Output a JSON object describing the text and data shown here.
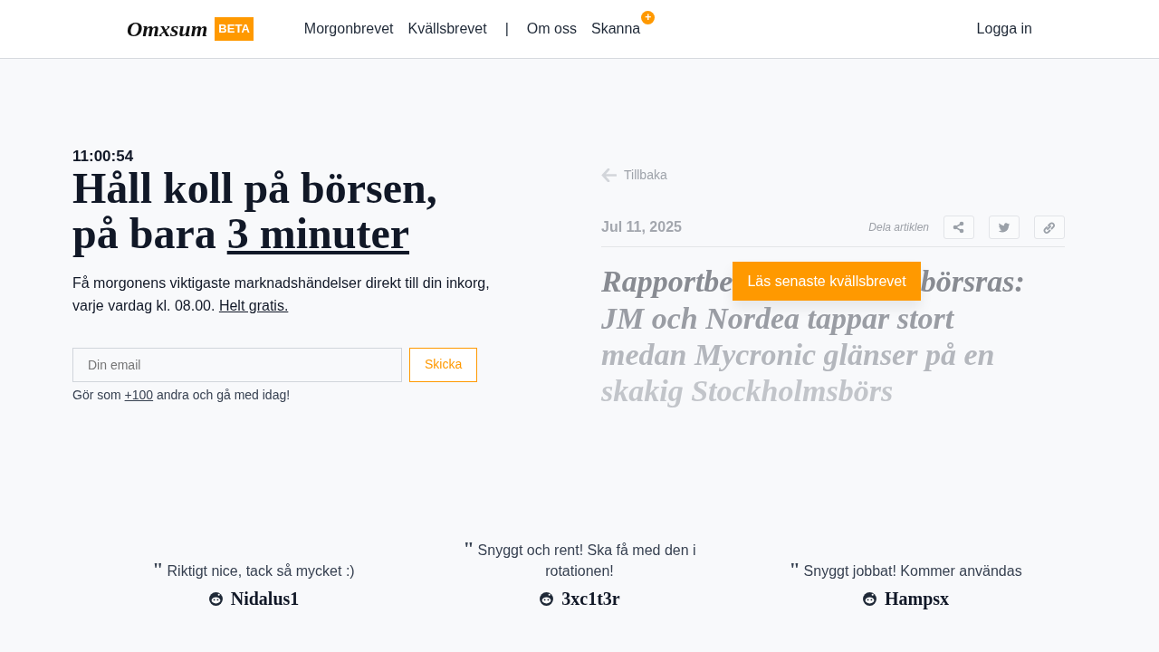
{
  "navbar": {
    "logo": "Omxsum",
    "badge": "BETA",
    "links": [
      {
        "label": "Morgonbrevet",
        "kind": "link"
      },
      {
        "label": "Kvällsbrevet",
        "kind": "link"
      },
      {
        "label": "|",
        "kind": "separator"
      },
      {
        "label": "Om oss",
        "kind": "link"
      },
      {
        "label": "Skanna",
        "kind": "link",
        "plus_badge": "+"
      }
    ],
    "login": "Logga in"
  },
  "hero": {
    "time": "11:00:54",
    "title_line1": "Håll koll på börsen,",
    "title_line2_prefix": "på bara ",
    "title_line2_link": "3 minuter",
    "lead": "Få morgonens viktigaste marknadshändelser direkt till din inkorg, varje vardag kl. 08.00. ",
    "lead_link": "Helt gratis.",
    "email_placeholder": "Din email",
    "submit": "Skicka",
    "note_prefix": "Gör som ",
    "note_link": "+100",
    "note_suffix": " andra och gå med idag!"
  },
  "article": {
    "back": "Tillbaka",
    "date": "Jul 11, 2025",
    "share_label": "Dela artiklen",
    "headline_line1_start": "Rapportbe",
    "headline_line1_end": "börsras:",
    "headline_lines": [
      "JM och Nordea tappar stort",
      "medan Mycronic glänser på en",
      "skakig Stockholmsbörs"
    ],
    "cta": "Läs senaste kvällsbrevet"
  },
  "testimonials": [
    {
      "mark": "\"",
      "text": "Riktigt nice, tack så mycket :)",
      "author": "Nidalus1"
    },
    {
      "mark": "\"",
      "text": "Snyggt och rent! Ska få med den i rotationen!",
      "author": "3xc1t3r"
    },
    {
      "mark": "\"",
      "text": "Snyggt jobbat! Kommer användas",
      "author": "Hampsx"
    }
  ]
}
